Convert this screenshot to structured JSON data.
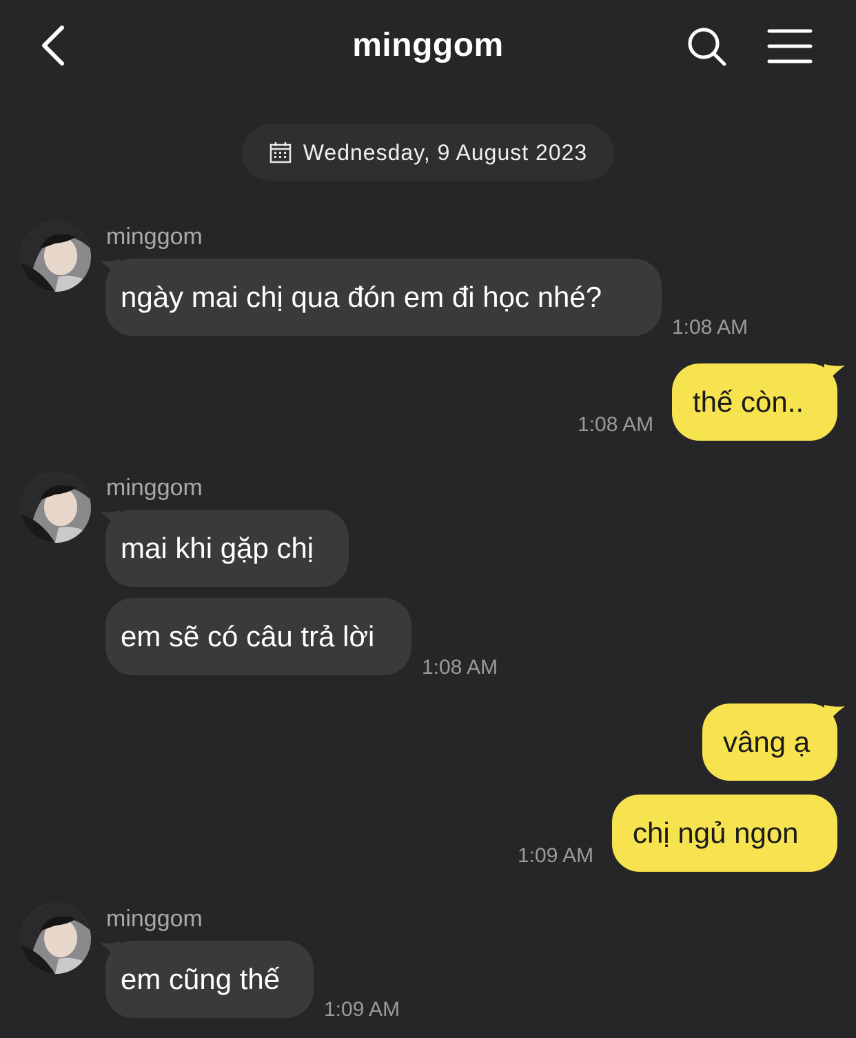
{
  "header": {
    "title": "minggom",
    "back_icon": "chevron-left-icon",
    "search_icon": "search-icon",
    "menu_icon": "hamburger-menu-icon"
  },
  "date_divider": {
    "icon": "calendar-icon",
    "text": "Wednesday, 9 August 2023"
  },
  "colors": {
    "background": "#262628",
    "incoming_bubble": "#3a3a3c",
    "outgoing_bubble": "#f7e34f",
    "timestamp": "#9a9a9c"
  },
  "messages": [
    {
      "direction": "incoming",
      "sender": "minggom",
      "text": "ngày mai chị qua đón em đi học nhé?",
      "time": "1:08 AM"
    },
    {
      "direction": "outgoing",
      "text": "thế còn..",
      "time": "1:08 AM"
    },
    {
      "direction": "incoming",
      "sender": "minggom",
      "text": "mai khi gặp chị"
    },
    {
      "direction": "incoming",
      "text": "em sẽ có câu trả lời",
      "time": "1:08 AM"
    },
    {
      "direction": "outgoing",
      "text": "vâng ạ"
    },
    {
      "direction": "outgoing",
      "text": "chị ngủ ngon",
      "time": "1:09 AM"
    },
    {
      "direction": "incoming",
      "sender": "minggom",
      "text": "em cũng thế",
      "time": "1:09 AM"
    }
  ]
}
